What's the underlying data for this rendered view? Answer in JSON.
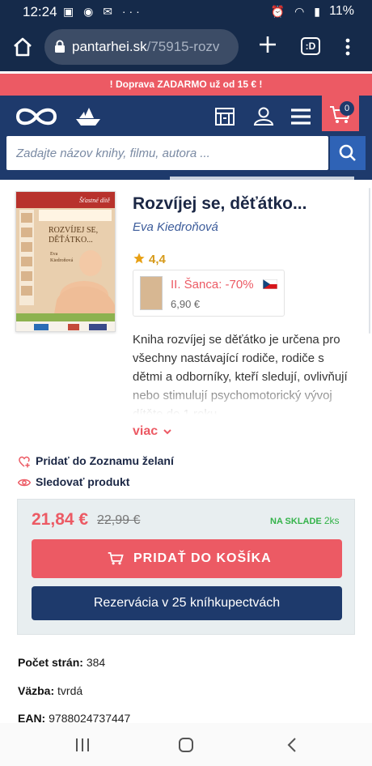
{
  "status_bar": {
    "time": "12:24",
    "left_icons": "▣ ◉ ✉ ···",
    "right_icons": "⏰ ◠ ▮",
    "battery": "11%"
  },
  "browser": {
    "url_domain": "pantarhei.sk",
    "url_path": "/75915-rozv",
    "tabs_label": ":D"
  },
  "promo_banner": "! Doprava ZADARMO už od 15 € !",
  "header": {
    "cart_count": "0",
    "search_placeholder": "Zadajte názov knihy, filmu, autora ..."
  },
  "product": {
    "title": "Rozvíjej se, děťátko...",
    "author": "Eva Kiedroňová",
    "rating": "4,4",
    "second_chance": {
      "label": "II. Šanca: -70%",
      "price": "6,90 €"
    },
    "description": "Kniha rozvíjej se děťátko je určena pro všechny nastávající rodiče, rodiče s dětmi a odborníky, kteří sledují, ovlivňují nebo stimulují psychomotorický vývoj dítěte do 1 roku",
    "more_label": "viac",
    "wishlist_label": "Pridať do Zoznamu želaní",
    "watch_label": "Sledovať produkt"
  },
  "cover": {
    "series": "Šťastné dítě",
    "title_line1": "ROZVÍJEJ SE,",
    "title_line2": "DĚŤÁTKO...",
    "author_line1": "Eva",
    "author_line2": "Kiedroňová"
  },
  "purchase": {
    "price": "21,84 €",
    "old_price": "22,99 €",
    "stock_label": "NA SKLADE",
    "stock_count": "2ks",
    "add_to_cart": "PRIDAŤ DO KOŠÍKA",
    "reserve": "Rezervácia v 25 kníhkupectvách"
  },
  "specs": [
    {
      "label": "Počet strán:",
      "value": "384"
    },
    {
      "label": "Väzba:",
      "value": "tvrdá"
    },
    {
      "label": "EAN:",
      "value": "9788024737447"
    }
  ],
  "colors": {
    "navy": "#1e3a6c",
    "accent": "#ec5a64",
    "link_blue": "#2f63b6",
    "stock_green": "#34b34a"
  }
}
